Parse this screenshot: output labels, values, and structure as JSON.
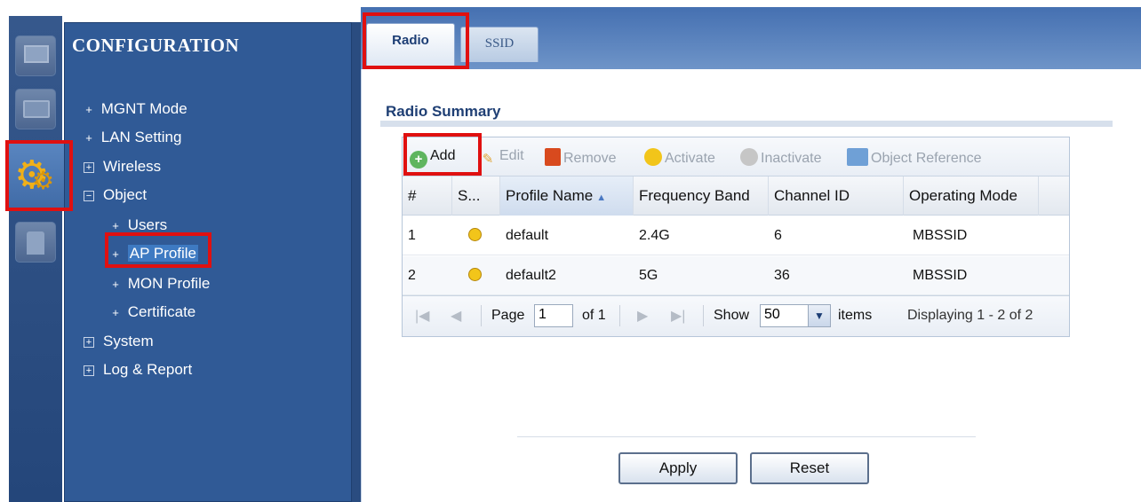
{
  "sidebar": {
    "title": "CONFIGURATION",
    "items": [
      {
        "label": "MGNT Mode",
        "marker": "+"
      },
      {
        "label": "LAN Setting",
        "marker": "+"
      },
      {
        "label": "Wireless",
        "marker": "⊞"
      },
      {
        "label": "Object",
        "marker": "⊟"
      },
      {
        "label": "Users",
        "marker": "+"
      },
      {
        "label": "AP Profile",
        "marker": "+"
      },
      {
        "label": "MON Profile",
        "marker": "+"
      },
      {
        "label": "Certificate",
        "marker": "+"
      },
      {
        "label": "System",
        "marker": "⊞"
      },
      {
        "label": "Log & Report",
        "marker": "⊞"
      }
    ]
  },
  "tabs": [
    "Radio",
    "SSID"
  ],
  "section_title": "Radio Summary",
  "toolbar": {
    "add": "Add",
    "edit": "Edit",
    "remove": "Remove",
    "activate": "Activate",
    "inactivate": "Inactivate",
    "object_reference": "Object Reference"
  },
  "table": {
    "headers": [
      "#",
      "S...",
      "Profile Name",
      "Frequency Band",
      "Channel ID",
      "Operating Mode"
    ],
    "rows": [
      {
        "num": "1",
        "profile": "default",
        "band": "2.4G",
        "channel": "6",
        "mode": "MBSSID"
      },
      {
        "num": "2",
        "profile": "default2",
        "band": "5G",
        "channel": "36",
        "mode": "MBSSID"
      }
    ]
  },
  "pager": {
    "page_label": "Page",
    "page_value": "1",
    "of_label": "of 1",
    "show_label": "Show",
    "show_value": "50",
    "items_label": "items",
    "displaying": "Displaying 1 - 2 of 2"
  },
  "buttons": {
    "apply": "Apply",
    "reset": "Reset"
  },
  "colors": {
    "sidebar_bg": "#305a96",
    "highlight_box": "#e01010",
    "section_title": "#1f3f74"
  }
}
